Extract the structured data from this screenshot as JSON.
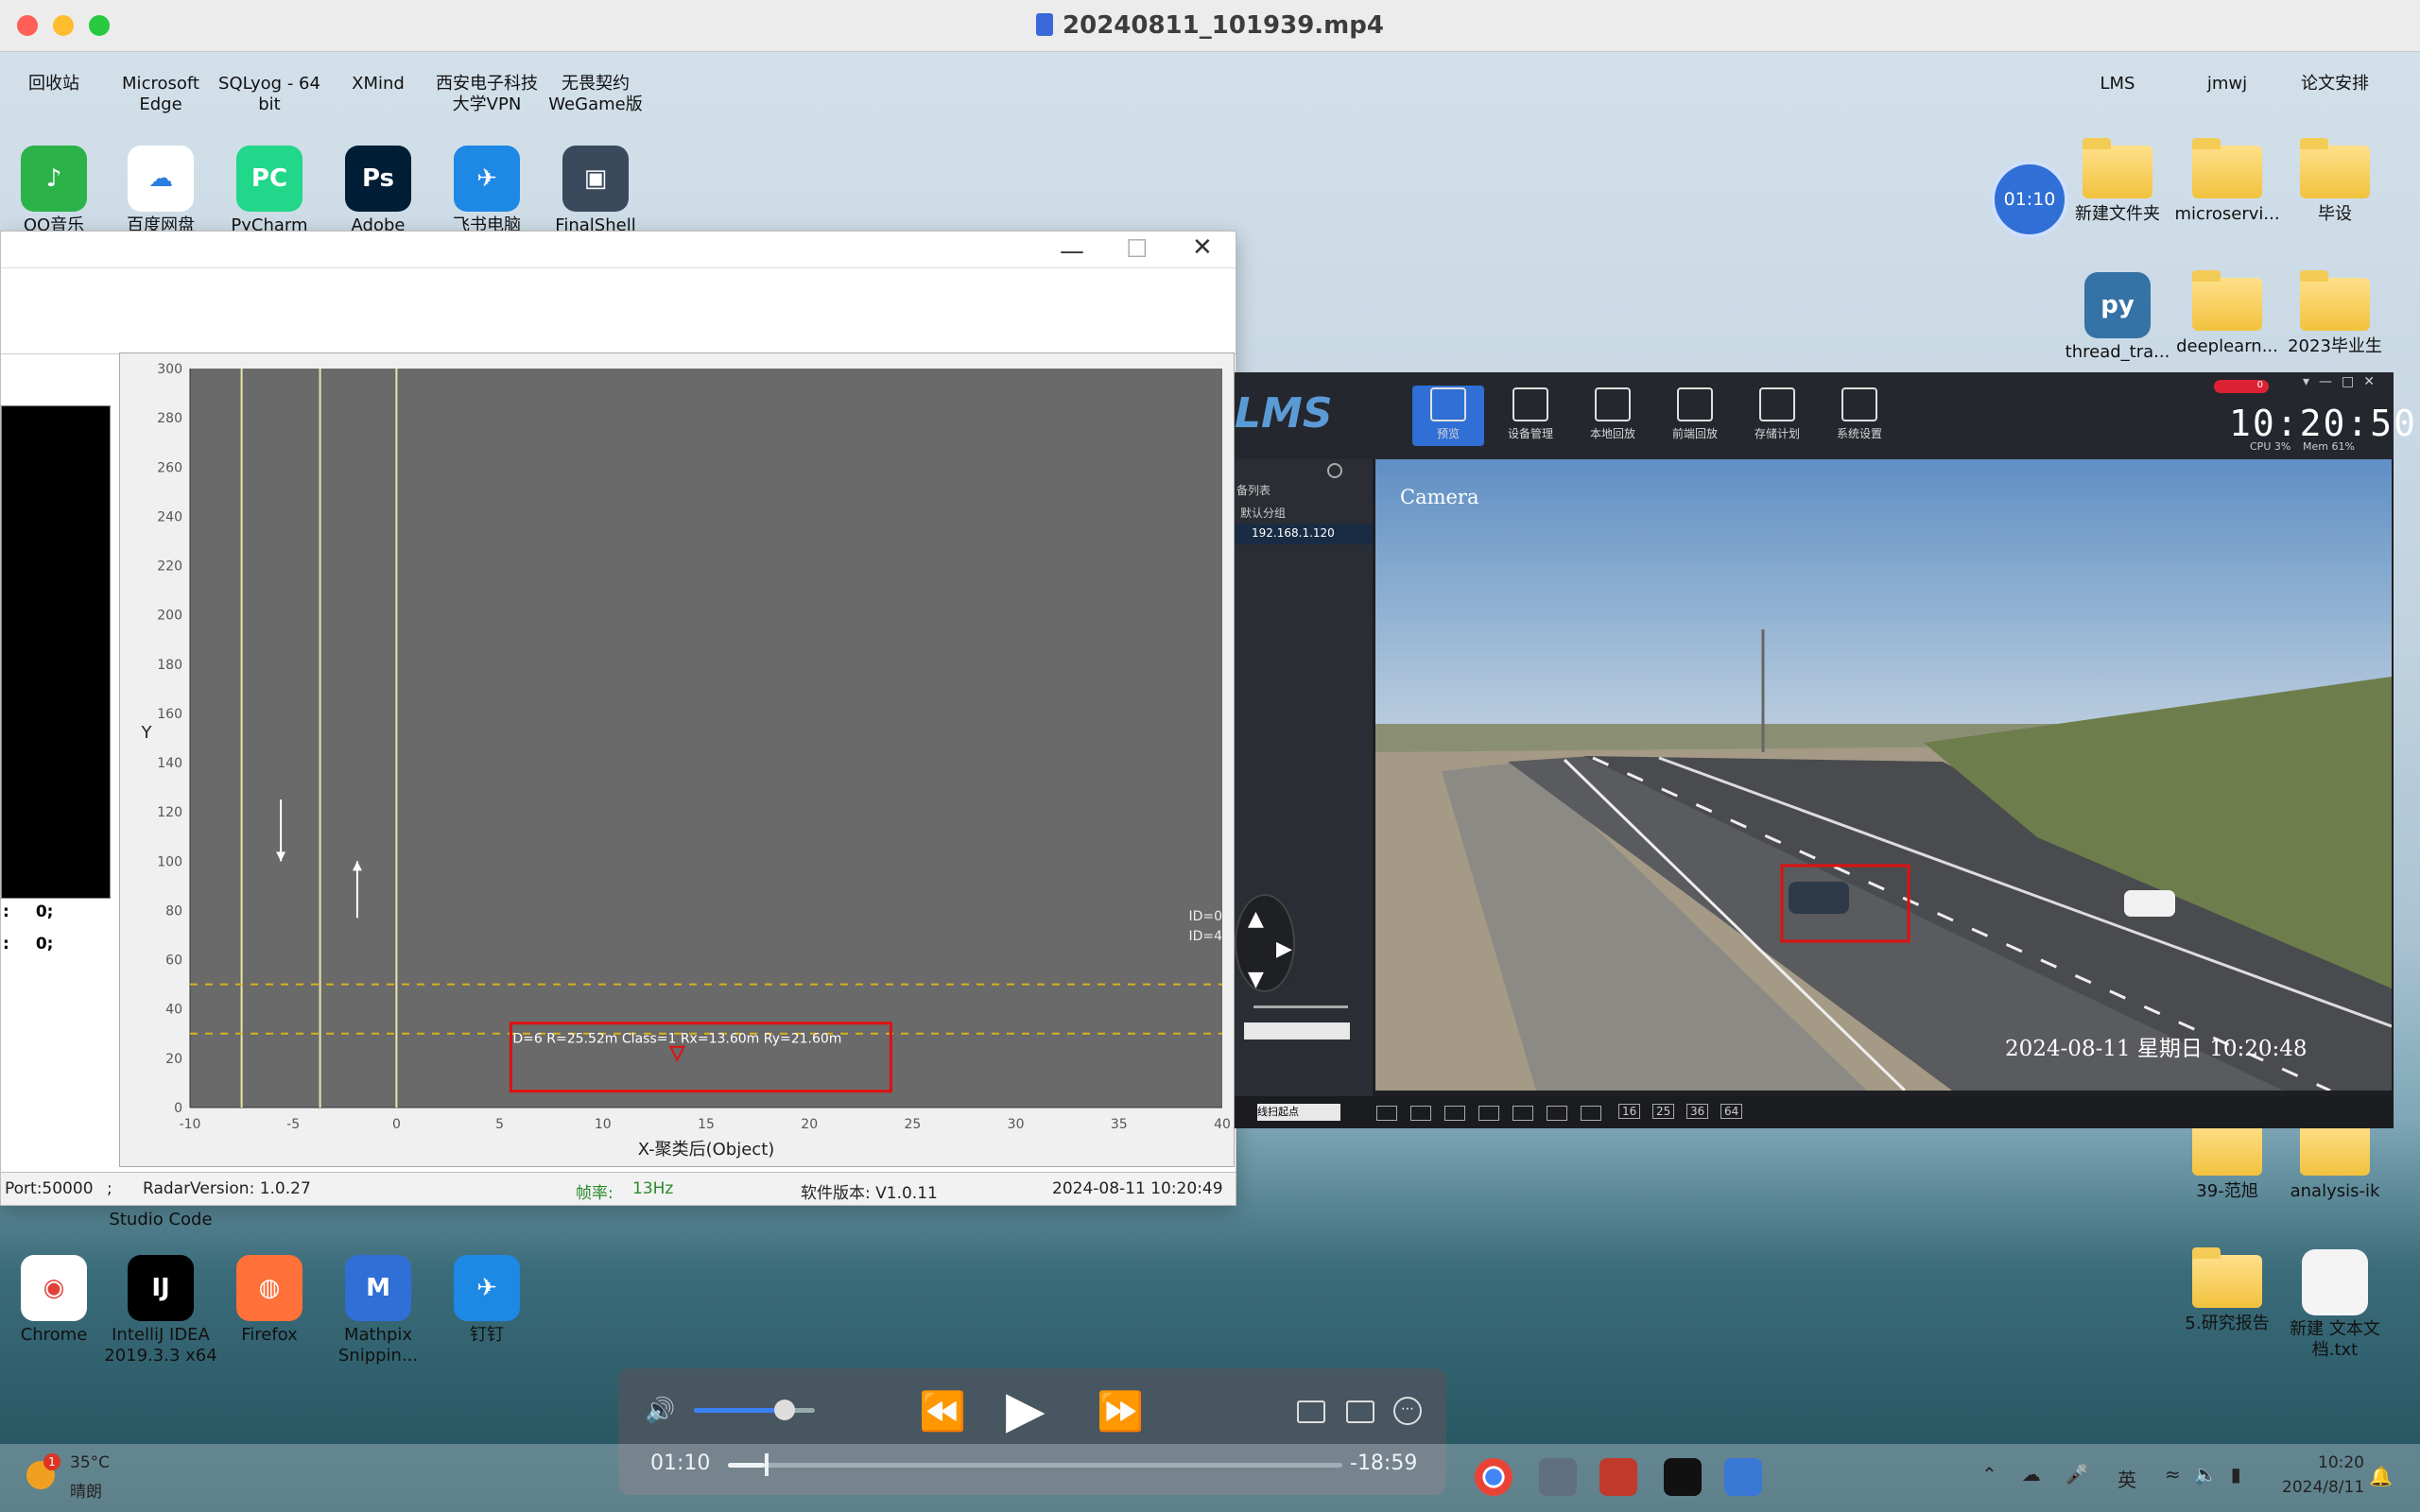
{
  "window_title": "20240811_101939.mp4",
  "desktop_icons_top": [
    "回收站",
    "Microsoft Edge",
    "SQLyog - 64 bit",
    "XMind",
    "西安电子科技大学VPN",
    "无畏契约WeGame版"
  ],
  "desktop_icons_row2": [
    "QQ音乐",
    "百度网盘",
    "PyCharm",
    "Adobe",
    "飞书电脑",
    "FinalShell"
  ],
  "desktop_icons_right": [
    "LMS",
    "jmwj",
    "论文安排",
    "新建文件夹",
    "microservi...",
    "毕设",
    "thread_tra...",
    "deeplearn...",
    "2023毕业生",
    "39-范旭",
    "analysis-ik",
    "5.研究报告",
    "新建 文本文档.txt"
  ],
  "desktop_icons_bottom": [
    "Chrome",
    "IntelliJ IDEA 2019.3.3 x64",
    "Firefox",
    "Mathpix Snippin...",
    "钉钉",
    "Studio Code"
  ],
  "timer_badge": "01:10",
  "radar_app": {
    "left_rows": [
      {
        "label": ":",
        "value": "0;"
      },
      {
        "label": ":",
        "value": "0;"
      }
    ],
    "side_ids": [
      "ID=0",
      "ID=4"
    ],
    "status": {
      "port": "Port:50000",
      "radar_version": "RadarVersion: 1.0.27",
      "freq_label": "帧率:",
      "freq_value": "13Hz",
      "software_version": "软件版本: V1.0.11",
      "datetime": "2024-08-11 10:20:49"
    }
  },
  "chart_data": {
    "type": "scatter",
    "xlabel": "X-聚类后(Object)",
    "ylabel": "Y",
    "xlim": [
      -10,
      40
    ],
    "ylim": [
      0,
      300
    ],
    "x_ticks": [
      -10,
      -5,
      0,
      5,
      10,
      15,
      20,
      25,
      30,
      35,
      40
    ],
    "y_ticks": [
      0,
      20,
      40,
      60,
      80,
      100,
      120,
      140,
      160,
      180,
      200,
      220,
      240,
      260,
      280,
      300
    ],
    "lane_lines_x": [
      -7.5,
      -3.7,
      0
    ],
    "dashed_lines_y": [
      30,
      50
    ],
    "arrows": [
      {
        "x": -5.6,
        "y_from": 125,
        "y_to": 100,
        "dir": "down"
      },
      {
        "x": -1.9,
        "y_from": 77,
        "y_to": 100,
        "dir": "up"
      }
    ],
    "points": [
      {
        "x": 13.6,
        "y": 21.6,
        "label": "D=6 R=25.52m Class=1 Rx=13.60m Ry=21.60m"
      }
    ],
    "grid": false
  },
  "lms_app": {
    "logo": "LMS",
    "toolbar": [
      "预览",
      "设备管理",
      "本地回放",
      "前端回放",
      "存储计划",
      "系统设置"
    ],
    "clock": "10:20:50",
    "cpu": "CPU 3%",
    "mem": "Mem 61%",
    "alarm_count": "0",
    "sidebar": {
      "list_title": "备列表",
      "group": "默认分组",
      "device": "192.168.1.120"
    },
    "camera_label": "Camera",
    "camera_osd": "2024-08-11  星期日  10:20:48",
    "bottom_select": "线扫起点",
    "layout_nums": [
      "16",
      "25",
      "36",
      "64"
    ]
  },
  "player": {
    "current_time": "01:10",
    "remaining_time": "-18:59",
    "volume": 0.75,
    "progress": 0.06
  },
  "taskbar": {
    "weather_temp": "35°C",
    "weather_desc": "晴朗",
    "weather_badge": "1",
    "ime": "英",
    "time": "10:20",
    "date": "2024/8/11"
  },
  "colors": {
    "plot_bg": "#6a6a6a",
    "lane_line": "#e8e6a8",
    "dashed": "#d6b21a",
    "highlight_box": "#e01010",
    "accent_freq": "#2a8a2a"
  }
}
